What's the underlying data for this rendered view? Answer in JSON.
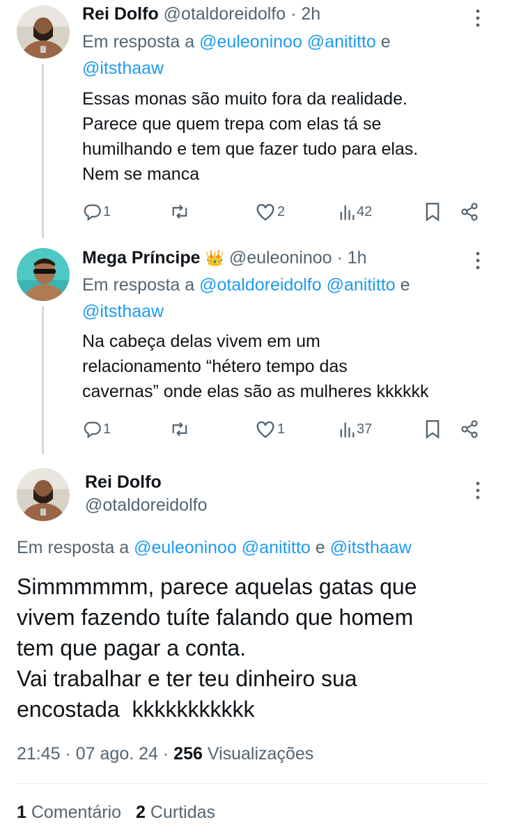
{
  "tweet1": {
    "name": "Rei Dolfo",
    "handle": "@otaldoreidolfo",
    "time": "· 2h",
    "reply_prefix": "Em resposta a",
    "reply_mentions_line1": "@euleoninoo @anititto",
    "reply_and": "e",
    "reply_mentions_line2": "@itsthaaw",
    "text_lines": [
      "Essas monas são muito fora da realidade.",
      "Parece que quem trepa com elas tá se",
      "humilhando e tem que fazer tudo para elas.",
      "Nem se manca"
    ],
    "replies": "1",
    "retweets": "",
    "likes": "2",
    "views": "42"
  },
  "tweet2": {
    "name": "Mega Príncipe",
    "crown_emoji": "👑",
    "handle": "@euleoninoo",
    "time": "· 1h",
    "reply_prefix": "Em resposta a",
    "reply_mentions_line1": "@otaldoreidolfo @anititto",
    "reply_and": "e",
    "reply_mentions_line2": "@itsthaaw",
    "text_lines": [
      "Na cabeça delas vivem em um",
      "relacionamento “hétero tempo das",
      "cavernas” onde elas são as mulheres kkkkkk"
    ],
    "replies": "1",
    "retweets": "",
    "likes": "1",
    "views": "37"
  },
  "main_tweet": {
    "name": "Rei Dolfo",
    "handle": "@otaldoreidolfo",
    "reply_prefix": "Em resposta a",
    "reply_mentions": "@euleoninoo @anititto",
    "reply_and": "e",
    "reply_mentions_last": "@itsthaaw",
    "text_lines": [
      "Simmmmmm, parece aquelas gatas que",
      "vivem fazendo tuíte falando que homem",
      "tem que pagar a conta.",
      "Vai trabalhar e ter teu dinheiro sua",
      "encostada  kkkkkkkkkkk"
    ],
    "time": "21:45 · 07 ago. 24 ·",
    "views_count": "256",
    "views_label": "Visualizações",
    "comments_count": "1",
    "comments_label": "Comentário",
    "retweets_count": "2",
    "retweets_label": "Curtidas"
  },
  "colors": {
    "text": "#0f1419",
    "secondary": "#536471",
    "link": "#1d9bf0",
    "thread_line": "#cfd9de"
  },
  "icons": [
    "more-icon",
    "reply-icon",
    "retweet-icon",
    "like-icon",
    "views-icon",
    "bookmark-icon",
    "share-icon"
  ]
}
